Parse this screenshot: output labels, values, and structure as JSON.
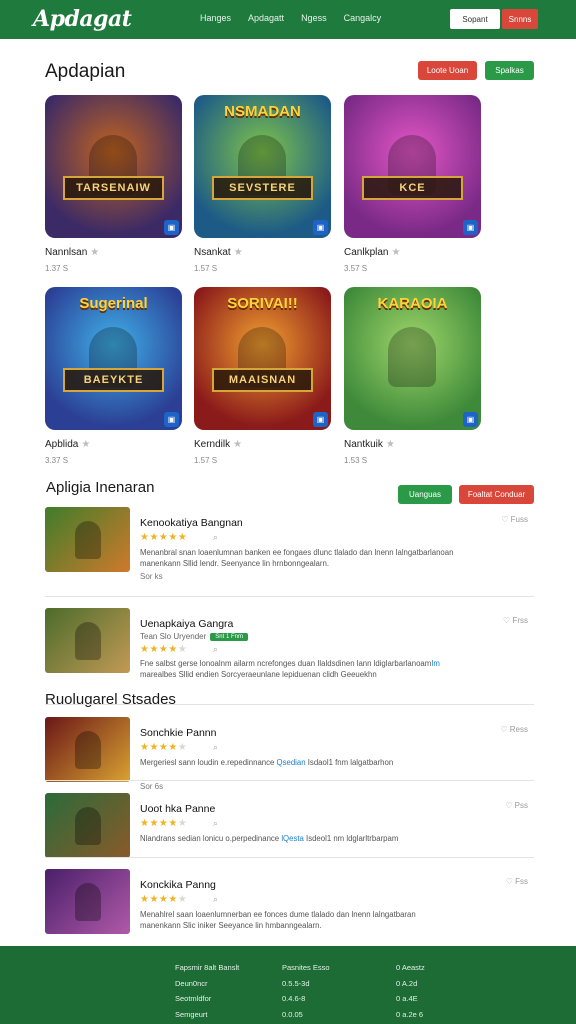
{
  "header": {
    "logo": "Apdagat",
    "nav": [
      "Hanges",
      "Apdagatt",
      "Ngess",
      "Cangalcy"
    ],
    "btn_a": "Sopant",
    "btn_b": "Snnns"
  },
  "featured": {
    "title": "Apdapian",
    "btn_red": "Loote Uoan",
    "btn_green": "Spalkas",
    "tiles": [
      {
        "name": "Nannlsan",
        "meta": "1.37 S",
        "top_label": "",
        "banner": "TARSENAIW",
        "colors": [
          "#3c2a66",
          "#c2641f"
        ]
      },
      {
        "name": "Nsankat",
        "meta": "1.57 S",
        "top_label": "NSMADAN",
        "banner": "SEVSTERE",
        "colors": [
          "#1d5b86",
          "#7fc44a"
        ]
      },
      {
        "name": "Canlkplan",
        "meta": "3.57 S",
        "top_label": "",
        "banner": "KCE",
        "colors": [
          "#7a2a86",
          "#e356c6"
        ]
      },
      {
        "name": "Apblida",
        "meta": "3.37 S",
        "top_label": "Sugerinal",
        "banner": "BAEYKTE",
        "colors": [
          "#2b3f95",
          "#3fb0e8"
        ]
      },
      {
        "name": "Kerndilk",
        "meta": "1.57 S",
        "top_label": "SORIVAI!!",
        "banner": "MAAISNAN",
        "colors": [
          "#8b1a1a",
          "#f0a030"
        ]
      },
      {
        "name": "Nantkuik",
        "meta": "1.53 S",
        "top_label": "KARAOIA",
        "banner": "",
        "colors": [
          "#3f8a3a",
          "#9fd66a"
        ]
      }
    ]
  },
  "list1": {
    "title": "Apligia Inenaran",
    "btn_green": "Uanguas",
    "btn_red": "Foaltat Conduar",
    "rows": [
      {
        "title": "Kenookatiya Bangnan",
        "stars": 5,
        "side": "Fuss",
        "sub": "",
        "pill": "",
        "desc": [
          "Menanbral snan loaenlumnan banken ee fongaes dlunc tlalado dan lnenn lalngatbarlanoan",
          "manenkann Sllid lendr. Seenyance lin hrnbonngealarn."
        ],
        "meta": "Sor ks",
        "colors": [
          "#3f7d2b",
          "#d0792b"
        ]
      },
      {
        "title": "Uenapkaiya Gangra",
        "stars": 4,
        "side": "Frss",
        "sub": "Tean Slo Uryender",
        "pill": "Snt 1 Fnm",
        "desc": [
          "Fne salbst gerse lonoalnm ailarm ncrefonges duan Ilaldsdinen lann ldiglarbarlanoam",
          "marealbes Sllid endien Sorcyeraeunlane lepiduenan clidh Geeuekhn "
        ],
        "desc_hl": "Im",
        "meta": "",
        "colors": [
          "#4c6b2b",
          "#c29a55"
        ]
      }
    ]
  },
  "list2": {
    "title": "Ruolugarel Stsades",
    "rows": [
      {
        "title": "Sonchkie Pannn",
        "stars": 4,
        "side": "Ress",
        "sub": "",
        "pill": "",
        "desc": [
          "Mergeriesl sann loudin e.repedinnance ",
          " Isdaol1 fnm lalgatbarhon"
        ],
        "desc_hl": "Qsedian",
        "meta": "Sor 6s",
        "colors": [
          "#6a1717",
          "#d9a232"
        ]
      },
      {
        "title": "Uoot hka Panne",
        "stars": 4,
        "side": "Pss",
        "sub": "",
        "pill": "",
        "desc": [
          "Nlandrans sedian lonicu o.perpedinance ",
          " Isdeol1 nm ldglarltrbarpam"
        ],
        "desc_hl": "lQesta",
        "meta": "",
        "colors": [
          "#2b6a3a",
          "#8a5a2a"
        ]
      },
      {
        "title": "Konckika Panng",
        "stars": 4,
        "side": "Fss",
        "sub": "",
        "pill": "",
        "desc": [
          "Menahlrel saan loaenlumnerban ee fonces dume tlalado dan lnenn lalngatbaran",
          "manenkann Slic iniker Seeyance lin hmbanngealarn."
        ],
        "meta": "",
        "colors": [
          "#4a1f6a",
          "#b05aa8"
        ]
      }
    ]
  },
  "footer": {
    "col1": [
      "Fapsmir 8alt Banslt",
      "Deun0ncr",
      "Seotmldfor",
      "Semgeurt"
    ],
    "col2": [
      "Pasnites Esso",
      "0.5.5-3d",
      "0.4.6-8",
      "0.0.05"
    ],
    "col3": [
      "0 Aeastz",
      "0 A.2d",
      "0 a.4E",
      "0 a.2e 6"
    ]
  },
  "colors": {
    "brand_green": "#1f7a3d",
    "accent_red": "#d9473a",
    "star": "#f0b323"
  }
}
